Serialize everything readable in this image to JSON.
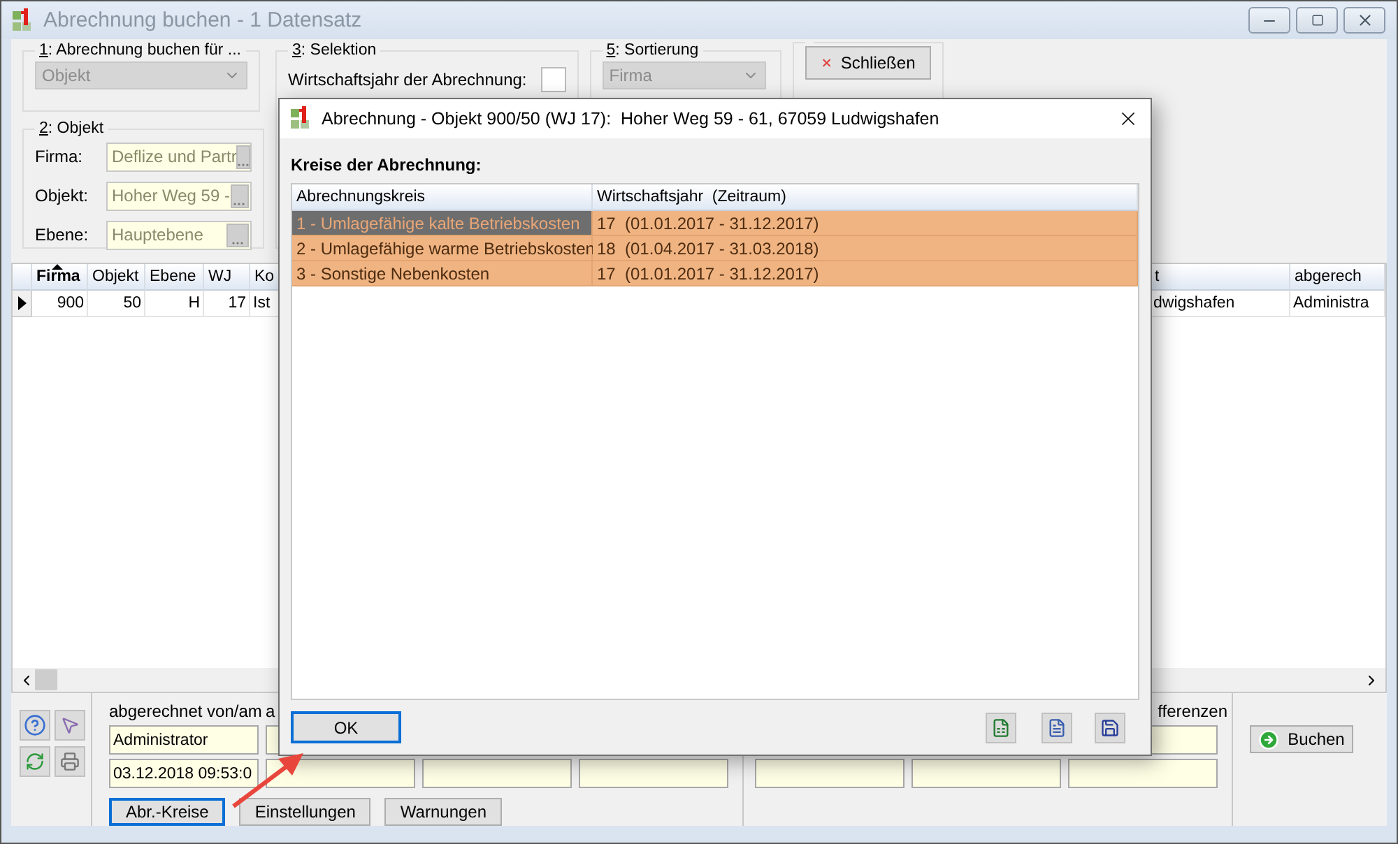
{
  "window": {
    "title": "Abrechnung buchen - 1 Datensatz",
    "active": false
  },
  "group_buchen_fuer": {
    "key": "1",
    "text": ": Abrechnung buchen für ...",
    "select": {
      "value": "Objekt",
      "disabled": true
    }
  },
  "group_objekt": {
    "key": "2",
    "text": ": Objekt",
    "fields": [
      {
        "label": "Firma:",
        "value": "Deflize und Partr"
      },
      {
        "label": "Objekt:",
        "value": "Hoher Weg 59 -"
      },
      {
        "label": "Ebene:",
        "value": "Hauptebene"
      }
    ]
  },
  "group_selektion": {
    "key": "3",
    "text": ": Selektion",
    "checkbox": {
      "label": "Wirtschaftsjahr der Abrechnung:",
      "checked": false
    }
  },
  "group_sortierung": {
    "key": "5",
    "text": ": Sortierung",
    "select": {
      "value": "Firma",
      "disabled": true
    }
  },
  "close_button": {
    "label": "Schließen"
  },
  "table": {
    "columns": [
      {
        "label": "Firma",
        "sorted": true
      },
      {
        "label": "Objekt",
        "sorted": false
      },
      {
        "label": "Ebene",
        "sorted": false
      },
      {
        "label": "WJ",
        "sorted": false
      },
      {
        "label": "Ko",
        "sorted": false
      }
    ],
    "right_columns": [
      "t",
      "abgerech"
    ],
    "rows": [
      {
        "current": true,
        "cells": [
          "900",
          "50",
          "H",
          "17",
          "Ist"
        ],
        "right_cells": [
          "dwigshafen",
          "Administra"
        ]
      }
    ]
  },
  "bottom": {
    "labels": [
      "abgerechnet von/am",
      "a"
    ],
    "user": "Administrator",
    "date": "03.12.2018 09:53:0",
    "buttons": [
      {
        "label": "Abr.-Kreise",
        "focused": true
      },
      {
        "label": "Einstellungen",
        "focused": false
      },
      {
        "label": "Warnungen",
        "focused": false
      }
    ],
    "label_right": "fferenzen",
    "book_button": "Buchen"
  },
  "dialog": {
    "title": "Abrechnung - Objekt 900/50 (WJ 17):  Hoher Weg 59 - 61, 67059 Ludwigshafen",
    "heading": "Kreise der Abrechnung:",
    "columns": [
      "Abrechnungskreis",
      "Wirtschaftsjahr  (Zeitraum)"
    ],
    "rows": [
      {
        "selected": true,
        "cells": [
          "1 - Umlagefähige kalte Betriebskosten",
          "17  (01.01.2017 - 31.12.2017)"
        ]
      },
      {
        "selected": false,
        "cells": [
          "2 - Umlagefähige warme Betriebskosten",
          "18  (01.04.2017 - 31.03.2018)"
        ]
      },
      {
        "selected": false,
        "cells": [
          "3 - Sonstige Nebenkosten",
          "17  (01.01.2017 - 31.12.2017)"
        ]
      }
    ],
    "ok": "OK"
  }
}
